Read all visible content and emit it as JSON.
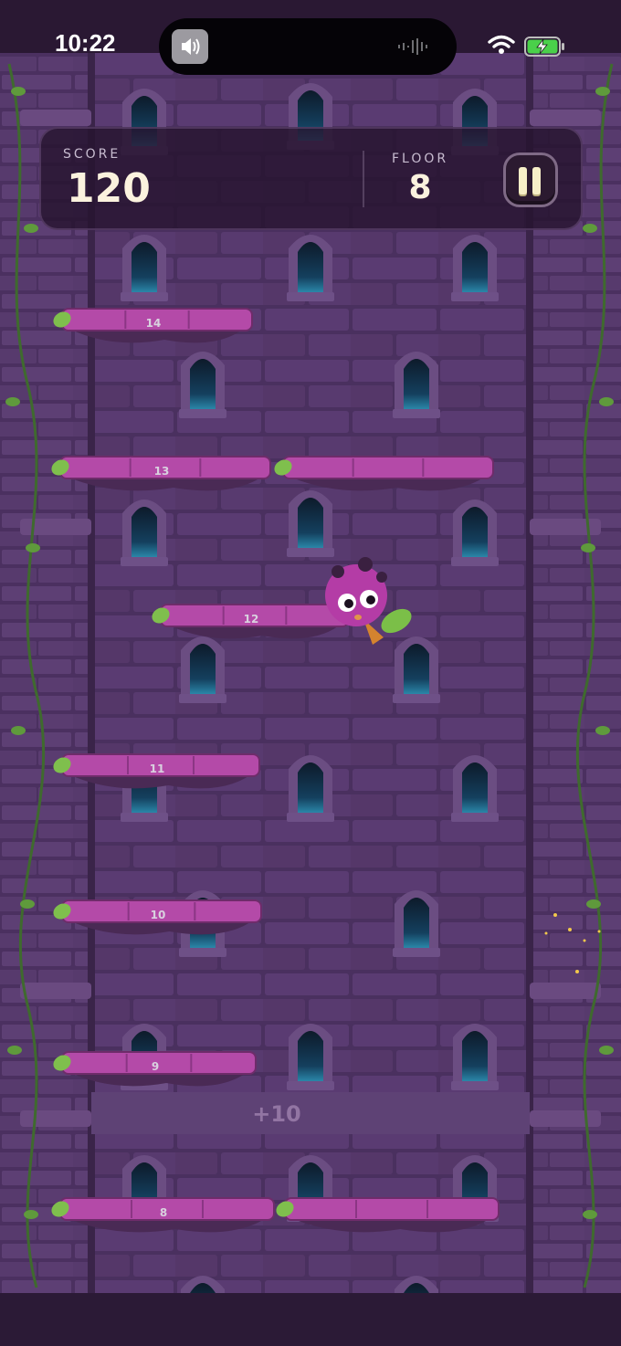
{
  "status_bar": {
    "time": "10:22",
    "icons": [
      "speaker-icon",
      "audio-waves-icon",
      "wifi-icon",
      "battery-charging-icon"
    ]
  },
  "hud": {
    "score_label": "SCORE",
    "score": "120",
    "floor_label": "FLOOR",
    "floor": "8",
    "pause_icon": "pause-icon"
  },
  "platforms": [
    {
      "label": "14"
    },
    {
      "label": "13"
    },
    {
      "label": "12"
    },
    {
      "label": "11"
    },
    {
      "label": "10"
    },
    {
      "label": "9"
    },
    {
      "label": "8"
    }
  ],
  "bonus_text": "+10",
  "colors": {
    "wall": "#4f3466",
    "brick": "#5c3d74",
    "platform": "#b44aa8",
    "leaf": "#7fbf4d",
    "window_glow": "#1d5f82",
    "hud_bg": "#26142e",
    "hud_text": "#fbf2de"
  }
}
